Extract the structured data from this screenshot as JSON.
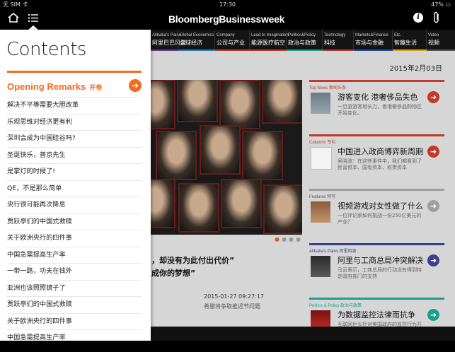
{
  "status_bar": {
    "carrier": "无 SIM 卡",
    "time": "17:30",
    "battery": "47%"
  },
  "brand": "BloombergBusinessweek",
  "categories": [
    {
      "en": "Alibaba's Pains",
      "zh": "阿里巴巴风波",
      "color": "#6a3c8c"
    },
    {
      "en": "Global Economics",
      "zh": "全球经济",
      "color": "#2a7db5"
    },
    {
      "en": "Company",
      "zh": "公司与产业",
      "color": "#c0392b"
    },
    {
      "en": "Lead to Imagination",
      "zh": "能源医疗航空",
      "color": "#c0392b"
    },
    {
      "en": "Politics&Policy",
      "zh": "政治与政策",
      "color": "#1aa08a"
    },
    {
      "en": "Technology",
      "zh": "科技",
      "color": "#c0392b"
    },
    {
      "en": "Markets&Finance",
      "zh": "市场与金融",
      "color": "#1f4e9c"
    },
    {
      "en": "Etc.",
      "zh": "智趣生活",
      "color": "#e0a21a"
    },
    {
      "en": "Video",
      "zh": "视频",
      "color": "#555555"
    }
  ],
  "date": "2015年2月03日",
  "hero": {
    "line1": "，却没有为此付出代价”",
    "line2": "成你的梦想”",
    "timestamp": "2015-01-27 09:27:17",
    "subtitle": "希腊将争取推迟节问题"
  },
  "side_stories": [
    {
      "section": "Top News 新闻头条",
      "title": "游客变化 港奢侈品失色",
      "summary": "一旦游游客增长力，香港奢侈品购物区开始变化。",
      "color": "#c0392b"
    },
    {
      "section": "Columns 专栏",
      "title": "中国进入政商博弈新周期",
      "summary": "吴晓波：在这些事件中，我们都看到了民营资本、国有资本、权贵资本",
      "color": "#c0392b"
    },
    {
      "section": "Features 特写",
      "title": "视频游戏对女性做了什么",
      "summary": "一位评论家如何挑战一份250亿美元的产业？",
      "color": "#9e9e9e"
    },
    {
      "section": "Alibaba's Pains 阿里风波",
      "title": "阿里与工商总局冲突解决",
      "summary": "马云表示，工商总局的行动没有得到特定政府部门的支持",
      "color": "#3b3f8f"
    },
    {
      "section": "Politics & Policy 政治与政策",
      "title": "为数据监控法律而抗争",
      "summary": "互联网巨头针对美国政府的监控行为开始有所行动",
      "color": "#1aa08a"
    }
  ],
  "panel": {
    "title": "Contents",
    "section_label": "Opening Remarks",
    "section_label_zh": "开卷",
    "items": [
      "解决不平等需要大胆改革",
      "乐观思维对经济更有利",
      "深圳会成为中国硅谷吗?",
      "圣诞快乐，普京先生",
      "是掌灯的时候了!",
      "QE，不是那么简单",
      "央行很可能再次降息",
      "贾跃亭们的中国式救赎",
      "关于欧洲央行的四件事",
      "中国急需提高生产率",
      "一带一路，功夫在钱外",
      "亚洲也该照照镜子了",
      "贾跃亭们的中国式救赎",
      "关于欧洲央行的四件事",
      "中国急需提高生产率"
    ]
  },
  "icons": {
    "home": "home-icon",
    "list": "list-icon",
    "info": "info-icon",
    "clip": "paperclip-icon",
    "wifi": "wifi-icon",
    "arrow": "arrow-right-icon"
  }
}
